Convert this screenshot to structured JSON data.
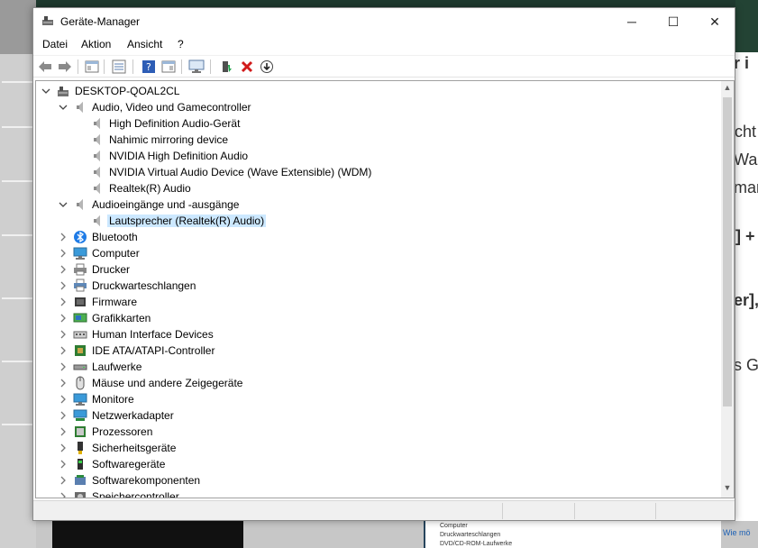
{
  "window": {
    "title": "Geräte-Manager",
    "controls": {
      "minimize": "─",
      "maximize": "☐",
      "close": "✕"
    }
  },
  "menu": [
    "Datei",
    "Aktion",
    "Ansicht",
    "?"
  ],
  "toolbar_icons": [
    "back-arrow-icon",
    "forward-arrow-icon",
    "properties-view-icon",
    "list-view-icon",
    "help-icon",
    "details-view-icon",
    "monitor-icon",
    "update-driver-icon",
    "uninstall-icon",
    "disable-device-icon"
  ],
  "tree": {
    "root": "DESKTOP-QOAL2CL",
    "items": [
      {
        "label": "Audio, Video und Gamecontroller",
        "expanded": true,
        "icon": "speaker-icon",
        "children": [
          "High Definition Audio-Gerät",
          "Nahimic mirroring device",
          "NVIDIA High Definition Audio",
          "NVIDIA Virtual Audio Device (Wave Extensible) (WDM)",
          "Realtek(R) Audio"
        ]
      },
      {
        "label": "Audioeingänge und -ausgänge",
        "expanded": true,
        "icon": "speaker-icon",
        "children": [
          "Lautsprecher (Realtek(R) Audio)"
        ],
        "selected_child": 0
      },
      {
        "label": "Bluetooth",
        "icon": "bluetooth-icon"
      },
      {
        "label": "Computer",
        "icon": "computer-icon"
      },
      {
        "label": "Drucker",
        "icon": "printer-icon"
      },
      {
        "label": "Druckwarteschlangen",
        "icon": "print-queue-icon"
      },
      {
        "label": "Firmware",
        "icon": "firmware-icon"
      },
      {
        "label": "Grafikkarten",
        "icon": "display-adapter-icon"
      },
      {
        "label": "Human Interface Devices",
        "icon": "hid-icon"
      },
      {
        "label": "IDE ATA/ATAPI-Controller",
        "icon": "ide-controller-icon"
      },
      {
        "label": "Laufwerke",
        "icon": "disk-drive-icon"
      },
      {
        "label": "Mäuse und andere Zeigegeräte",
        "icon": "mouse-icon"
      },
      {
        "label": "Monitore",
        "icon": "monitor-icon"
      },
      {
        "label": "Netzwerkadapter",
        "icon": "network-adapter-icon"
      },
      {
        "label": "Prozessoren",
        "icon": "processor-icon"
      },
      {
        "label": "Sicherheitsgeräte",
        "icon": "security-device-icon"
      },
      {
        "label": "Softwaregeräte",
        "icon": "software-device-icon"
      },
      {
        "label": "Softwarekomponenten",
        "icon": "software-component-icon"
      },
      {
        "label": "Speichercontroller",
        "icon": "storage-controller-icon"
      }
    ]
  },
  "background": {
    "right_fragments": [
      "r i",
      "cht",
      "War",
      "mar",
      "] +",
      "er],",
      "s Ge"
    ],
    "mini_window": [
      "Computer",
      "Druckwarteschlangen",
      "DVD/CD-ROM-Laufwerke"
    ],
    "link": "Wie mö"
  },
  "colors": {
    "selection": "#cce8ff",
    "bluetooth": "#1e7be6",
    "uninstall": "#d11a1a"
  }
}
